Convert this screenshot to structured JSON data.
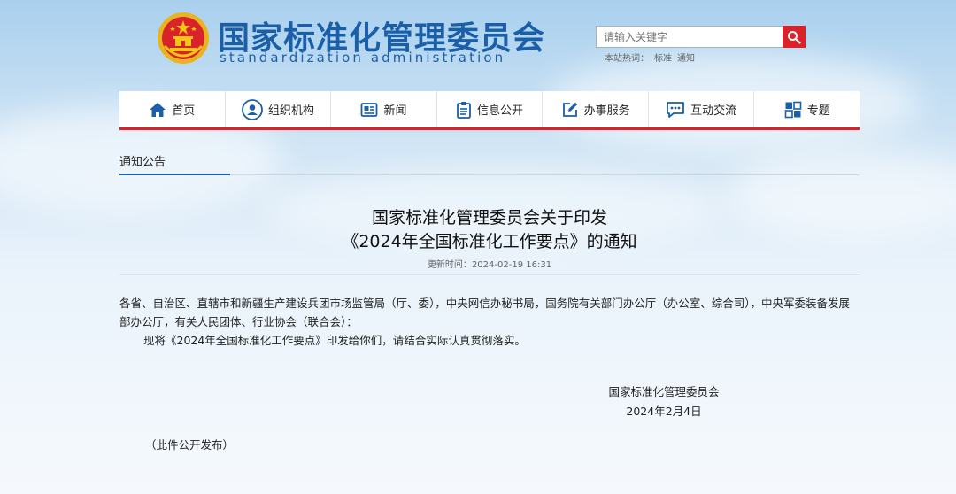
{
  "header": {
    "title": "国家标准化管理委员会",
    "subtitle": "standardization administration",
    "search": {
      "placeholder": "请输入关键字"
    },
    "hot_label": "本站热词：",
    "hot_words": [
      "标准",
      "通知"
    ]
  },
  "nav": {
    "items": [
      {
        "label": "首页",
        "icon": "home-icon"
      },
      {
        "label": "组织机构",
        "icon": "org-user-icon"
      },
      {
        "label": "新闻",
        "icon": "news-icon"
      },
      {
        "label": "信息公开",
        "icon": "clipboard-icon"
      },
      {
        "label": "办事服务",
        "icon": "edit-icon"
      },
      {
        "label": "互动交流",
        "icon": "chat-icon"
      },
      {
        "label": "专题",
        "icon": "puzzle-icon"
      }
    ]
  },
  "section": {
    "tab_label": "通知公告"
  },
  "article": {
    "title_line1": "国家标准化管理委员会关于印发",
    "title_line2": "《2024年全国标准化工作要点》的通知",
    "updated_label": "更新时间：",
    "updated_value": "2024-02-19 16:31",
    "para1": "各省、自治区、直辖市和新疆生产建设兵团市场监管局（厅、委），中央网信办秘书局，国务院有关部门办公厅（办公室、综合司），中央军委装备发展部办公厅，有关人民团体、行业协会（联合会）：",
    "para2": "现将《2024年全国标准化工作要点》印发给你们，请结合实际认真贯彻落实。",
    "signer": "国家标准化管理委员会",
    "date": "2024年2月4日",
    "note": "（此件公开发布）"
  },
  "colors": {
    "brand_blue": "#1a5fa8",
    "accent_red": "#d8232a"
  }
}
